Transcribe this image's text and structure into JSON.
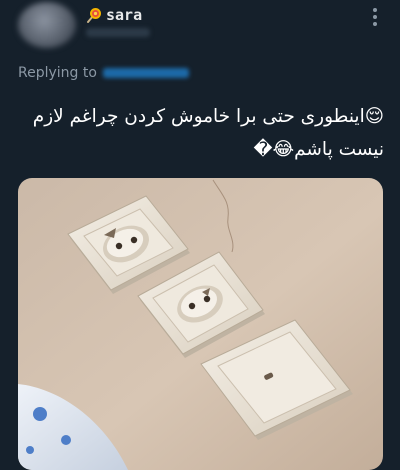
{
  "header": {
    "display_name": "sara",
    "name_emoji_icon": "lollipop-icon",
    "handle": "",
    "more_icon": "more-vertical-icon"
  },
  "reply": {
    "prefix": "Replying to",
    "target_handle": ""
  },
  "tweet": {
    "text_line1": "😌اینطوری حتی برا خاموش کردن چراغم لازم",
    "text_line2": "نیست پاشم😂�"
  },
  "media": {
    "description_icon": "photo-of-wall-outlets-and-switch"
  },
  "colors": {
    "background": "#15202b",
    "text_primary": "#ffffff",
    "text_secondary": "#8b98a5",
    "link": "#1d9bf0"
  }
}
